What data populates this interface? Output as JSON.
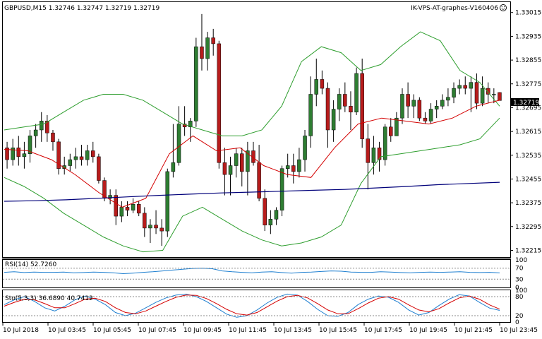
{
  "header": {
    "symbol_info": "GBPUSD,M15  1.32746 1.32747 1.32719 1.32719",
    "server_label": "IK-VPS-AT-graphes-V160406",
    "server_icon": "smiley-icon"
  },
  "colors": {
    "bull_body": "#2e7d32",
    "bear_body": "#b71c1c",
    "bollinger": "#2e9e2e",
    "ma_fast": "#d40000",
    "ma_slow": "#00007a",
    "rsi_line": "#1e7fd0",
    "stoch_main": "#1e7fd0",
    "stoch_signal": "#d40000",
    "grid_dotted": "#888888",
    "price_tag_bg": "#000000"
  },
  "chart_data": [
    {
      "type": "candlestick",
      "panel": "main",
      "symbol": "GBPUSD",
      "timeframe": "M15",
      "ylim": [
        1.3219,
        1.3305
      ],
      "y_ticks": [
        "1.33015",
        "1.32935",
        "1.32855",
        "1.32775",
        "1.32695",
        "1.32615",
        "1.32535",
        "1.32455",
        "1.32375",
        "1.32295",
        "1.32215"
      ],
      "current_price": "1.32719",
      "candles": [
        [
          1.3256,
          1.3258,
          1.3249,
          1.3252
        ],
        [
          1.3252,
          1.3259,
          1.325,
          1.3256
        ],
        [
          1.3256,
          1.326,
          1.325,
          1.3253
        ],
        [
          1.3253,
          1.3258,
          1.3249,
          1.3254
        ],
        [
          1.3254,
          1.3262,
          1.3251,
          1.326
        ],
        [
          1.326,
          1.3264,
          1.3256,
          1.3262
        ],
        [
          1.3262,
          1.3268,
          1.3258,
          1.3265
        ],
        [
          1.3265,
          1.3267,
          1.3258,
          1.3261
        ],
        [
          1.3261,
          1.3262,
          1.3255,
          1.3258
        ],
        [
          1.3258,
          1.3259,
          1.3247,
          1.3249
        ],
        [
          1.3249,
          1.3253,
          1.3247,
          1.325
        ],
        [
          1.325,
          1.3254,
          1.3248,
          1.3252
        ],
        [
          1.3252,
          1.3256,
          1.3249,
          1.3253
        ],
        [
          1.3253,
          1.3257,
          1.325,
          1.3252
        ],
        [
          1.3252,
          1.3257,
          1.325,
          1.3255
        ],
        [
          1.3255,
          1.3258,
          1.3251,
          1.3253
        ],
        [
          1.3253,
          1.3254,
          1.3244,
          1.3245
        ],
        [
          1.3245,
          1.3246,
          1.3238,
          1.3239
        ],
        [
          1.3239,
          1.3242,
          1.3237,
          1.324
        ],
        [
          1.324,
          1.3242,
          1.323,
          1.3233
        ],
        [
          1.3233,
          1.3238,
          1.3231,
          1.3236
        ],
        [
          1.3236,
          1.3238,
          1.3233,
          1.3235
        ],
        [
          1.3235,
          1.3239,
          1.3234,
          1.3237
        ],
        [
          1.3237,
          1.3238,
          1.3233,
          1.3234
        ],
        [
          1.3234,
          1.3236,
          1.3226,
          1.3229
        ],
        [
          1.3229,
          1.3232,
          1.3224,
          1.323
        ],
        [
          1.323,
          1.3235,
          1.3227,
          1.3229
        ],
        [
          1.3229,
          1.3232,
          1.3223,
          1.3228
        ],
        [
          1.3228,
          1.3249,
          1.3226,
          1.3248
        ],
        [
          1.3248,
          1.3264,
          1.3246,
          1.3251
        ],
        [
          1.3251,
          1.327,
          1.325,
          1.3264
        ],
        [
          1.3264,
          1.327,
          1.326,
          1.3263
        ],
        [
          1.3263,
          1.3266,
          1.3258,
          1.3265
        ],
        [
          1.3265,
          1.3293,
          1.3263,
          1.329
        ],
        [
          1.329,
          1.3301,
          1.3282,
          1.3286
        ],
        [
          1.3286,
          1.3295,
          1.3282,
          1.3293
        ],
        [
          1.3293,
          1.3296,
          1.3287,
          1.3291
        ],
        [
          1.3291,
          1.3292,
          1.3249,
          1.3251
        ],
        [
          1.3251,
          1.3256,
          1.324,
          1.3247
        ],
        [
          1.3247,
          1.3253,
          1.324,
          1.325
        ],
        [
          1.325,
          1.3256,
          1.3246,
          1.3254
        ],
        [
          1.3254,
          1.3256,
          1.3243,
          1.3248
        ],
        [
          1.3248,
          1.3258,
          1.324,
          1.3255
        ],
        [
          1.3255,
          1.3258,
          1.325,
          1.3251
        ],
        [
          1.3251,
          1.3257,
          1.3238,
          1.3239
        ],
        [
          1.3239,
          1.3242,
          1.3228,
          1.323
        ],
        [
          1.323,
          1.3235,
          1.3227,
          1.3232
        ],
        [
          1.3232,
          1.3236,
          1.323,
          1.3235
        ],
        [
          1.3235,
          1.325,
          1.3233,
          1.3249
        ],
        [
          1.3249,
          1.3254,
          1.3246,
          1.325
        ],
        [
          1.325,
          1.3254,
          1.3244,
          1.3248
        ],
        [
          1.3248,
          1.3256,
          1.3246,
          1.3252
        ],
        [
          1.3252,
          1.3262,
          1.3248,
          1.326
        ],
        [
          1.326,
          1.328,
          1.3256,
          1.3274
        ],
        [
          1.3274,
          1.3286,
          1.327,
          1.3279
        ],
        [
          1.3279,
          1.3282,
          1.3274,
          1.3276
        ],
        [
          1.3276,
          1.3278,
          1.3256,
          1.3262
        ],
        [
          1.3262,
          1.3272,
          1.3258,
          1.3269
        ],
        [
          1.3269,
          1.3276,
          1.3265,
          1.3274
        ],
        [
          1.3274,
          1.3278,
          1.3268,
          1.327
        ],
        [
          1.327,
          1.3275,
          1.3262,
          1.3268
        ],
        [
          1.3268,
          1.3283,
          1.3267,
          1.3281
        ],
        [
          1.3281,
          1.3286,
          1.3256,
          1.3259
        ],
        [
          1.3259,
          1.3264,
          1.3242,
          1.3251
        ],
        [
          1.3251,
          1.326,
          1.3247,
          1.3256
        ],
        [
          1.3256,
          1.3258,
          1.3248,
          1.3252
        ],
        [
          1.3252,
          1.3264,
          1.325,
          1.3263
        ],
        [
          1.3263,
          1.3266,
          1.3258,
          1.326
        ],
        [
          1.326,
          1.3268,
          1.326,
          1.3266
        ],
        [
          1.3266,
          1.3276,
          1.3264,
          1.3274
        ],
        [
          1.3274,
          1.3278,
          1.3266,
          1.327
        ],
        [
          1.327,
          1.3274,
          1.3266,
          1.3272
        ],
        [
          1.3272,
          1.3273,
          1.3265,
          1.3266
        ],
        [
          1.3266,
          1.3268,
          1.3264,
          1.3265
        ],
        [
          1.3265,
          1.3271,
          1.3264,
          1.3269
        ],
        [
          1.3269,
          1.3272,
          1.3266,
          1.327
        ],
        [
          1.327,
          1.3274,
          1.3269,
          1.3272
        ],
        [
          1.3272,
          1.3276,
          1.327,
          1.3273
        ],
        [
          1.3273,
          1.3278,
          1.3271,
          1.3276
        ],
        [
          1.3276,
          1.3279,
          1.3274,
          1.3277
        ],
        [
          1.3277,
          1.328,
          1.3274,
          1.3276
        ],
        [
          1.3276,
          1.328,
          1.3268,
          1.3278
        ],
        [
          1.3278,
          1.3281,
          1.3269,
          1.3271
        ],
        [
          1.3271,
          1.328,
          1.327,
          1.3276
        ],
        [
          1.3276,
          1.3278,
          1.3271,
          1.3274
        ],
        [
          1.3274,
          1.3276,
          1.3271,
          1.3274
        ],
        [
          1.32746,
          1.32747,
          1.32719,
          1.32719
        ]
      ],
      "bollinger_bands": {
        "upper": [
          1.3262,
          1.3263,
          1.3264,
          1.3268,
          1.3272,
          1.3274,
          1.3274,
          1.3272,
          1.3268,
          1.3264,
          1.3262,
          1.326,
          1.326,
          1.3262,
          1.327,
          1.3285,
          1.329,
          1.3288,
          1.3282,
          1.3284,
          1.329,
          1.3295,
          1.3292,
          1.3282,
          1.3278,
          1.327
        ],
        "lower": [
          1.3246,
          1.3243,
          1.3239,
          1.3234,
          1.323,
          1.3226,
          1.3223,
          1.3221,
          1.32215,
          1.3233,
          1.3236,
          1.3232,
          1.3228,
          1.3225,
          1.3223,
          1.3224,
          1.3226,
          1.323,
          1.3244,
          1.3253,
          1.3254,
          1.3255,
          1.3256,
          1.3257,
          1.3259,
          1.3266
        ]
      },
      "ma_fast": [
        1.32555,
        1.3255,
        1.3252,
        1.3247,
        1.3241,
        1.3236,
        1.3239,
        1.3254,
        1.326,
        1.3255,
        1.3256,
        1.325,
        1.3247,
        1.3246,
        1.3256,
        1.3264,
        1.3266,
        1.3265,
        1.3264,
        1.3266,
        1.327,
        1.3272
      ],
      "ma_slow": [
        1.3238,
        1.32382,
        1.32385,
        1.3239,
        1.32395,
        1.324,
        1.32404,
        1.32408,
        1.32411,
        1.32414,
        1.32417,
        1.3242,
        1.32425,
        1.3243,
        1.32436,
        1.3244,
        1.32444
      ]
    },
    {
      "type": "line",
      "panel": "rsi",
      "label": "RSI(14) 52.7260",
      "ylim": [
        0,
        100
      ],
      "y_ticks": [
        "100",
        "70",
        "30",
        "0"
      ],
      "levels": [
        70,
        30
      ],
      "values": [
        55,
        57,
        54,
        56,
        55,
        55,
        56,
        53,
        54,
        56,
        55,
        53,
        50,
        52,
        55,
        57,
        60,
        63,
        66,
        69,
        70,
        68,
        60,
        57,
        55,
        53,
        56,
        57,
        54,
        52,
        55,
        56,
        58,
        60,
        59,
        56,
        55,
        55,
        57,
        56,
        54,
        53,
        55,
        56,
        55,
        56,
        57,
        55,
        54,
        55,
        52.726
      ]
    },
    {
      "type": "line",
      "panel": "stochastic",
      "label": "Sto(5,3,3) 36.6890 40.7412",
      "ylim": [
        0,
        100
      ],
      "y_ticks": [
        "100",
        "80",
        "20",
        "0"
      ],
      "levels": [
        80,
        20
      ],
      "series": [
        {
          "values": [
            55,
            70,
            80,
            65,
            45,
            35,
            50,
            70,
            82,
            72,
            55,
            30,
            20,
            28,
            45,
            62,
            76,
            85,
            88,
            80,
            65,
            45,
            25,
            15,
            20,
            38,
            60,
            78,
            88,
            85,
            65,
            40,
            20,
            18,
            30,
            55,
            72,
            82,
            78,
            62,
            38,
            22,
            30,
            52,
            72,
            86,
            82,
            62,
            44,
            36.689
          ]
        },
        {
          "values": [
            50,
            62,
            72,
            70,
            58,
            45,
            45,
            58,
            72,
            75,
            65,
            45,
            30,
            26,
            35,
            50,
            65,
            78,
            85,
            84,
            74,
            58,
            40,
            26,
            22,
            30,
            48,
            66,
            80,
            84,
            76,
            58,
            38,
            26,
            26,
            42,
            60,
            75,
            80,
            72,
            54,
            38,
            32,
            42,
            60,
            76,
            82,
            72,
            54,
            40.7412
          ]
        }
      ]
    }
  ],
  "x_axis": {
    "tick_labels": [
      "10 Jul 2018",
      "10 Jul 03:45",
      "10 Jul 05:45",
      "10 Jul 07:45",
      "10 Jul 09:45",
      "10 Jul 11:45",
      "10 Jul 13:45",
      "10 Jul 15:45",
      "10 Jul 17:45",
      "10 Jul 19:45",
      "10 Jul 21:45",
      "10 Jul 23:45"
    ]
  }
}
